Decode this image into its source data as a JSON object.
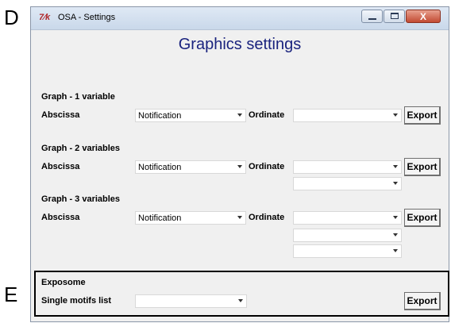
{
  "panel_letters": {
    "top": "D",
    "bottom": "E"
  },
  "window": {
    "title": "OSA - Settings",
    "icon": "tk-feather-icon",
    "controls": {
      "minimize": "minimize-icon",
      "maximize": "maximize-icon",
      "close_glyph": "X"
    }
  },
  "heading": "Graphics settings",
  "graphs": [
    {
      "title": "Graph - 1 variable",
      "abscissa_label": "Abscissa",
      "abscissa_value": "Notification",
      "ordinate_label": "Ordinate",
      "ordinate_values": [
        ""
      ],
      "export_label": "Export"
    },
    {
      "title": "Graph - 2 variables",
      "abscissa_label": "Abscissa",
      "abscissa_value": "Notification",
      "ordinate_label": "Ordinate",
      "ordinate_values": [
        "",
        ""
      ],
      "export_label": "Export"
    },
    {
      "title": "Graph - 3 variables",
      "abscissa_label": "Abscissa",
      "abscissa_value": "Notification",
      "ordinate_label": "Ordinate",
      "ordinate_values": [
        "",
        "",
        ""
      ],
      "export_label": "Export"
    }
  ],
  "exposome": {
    "title": "Exposome",
    "motifs_label": "Single motifs list",
    "motifs_value": "",
    "export_label": "Export"
  }
}
